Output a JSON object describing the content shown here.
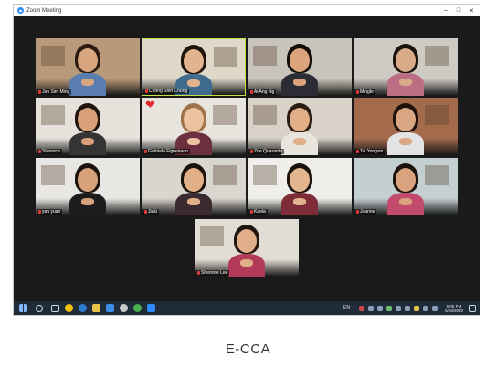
{
  "window": {
    "title": "Zoom Meeting"
  },
  "tiles": [
    {
      "name": "Jan Sim Ming",
      "bg": "#b89a7a",
      "skin": "#d7a57e",
      "hair": "#2a1a10",
      "shirt": "#5a7db0",
      "muted": true
    },
    {
      "name": "Chong Shin Chong",
      "bg": "#ded8c8",
      "skin": "#e2b48e",
      "hair": "#1e140c",
      "shirt": "#3f6b8c",
      "muted": true,
      "active": true
    },
    {
      "name": "Ai Ang Ng",
      "bg": "#c9c4bb",
      "skin": "#dba47c",
      "hair": "#150d08",
      "shirt": "#2c2c34",
      "muted": true
    },
    {
      "name": "Mingle",
      "bg": "#cfcac3",
      "skin": "#d9ab88",
      "hair": "#1a120c",
      "shirt": "#ba6d83",
      "muted": true
    },
    {
      "name": "Shernice",
      "bg": "#e6e2db",
      "skin": "#d7a07a",
      "hair": "#1f150d",
      "shirt": "#343434",
      "muted": true
    },
    {
      "name": "Gabriela Figueiredo",
      "bg": "#e8e4de",
      "skin": "#ebc3a0",
      "hair": "#a0724a",
      "shirt": "#6b2f3f",
      "muted": true
    },
    {
      "name": "Zoe Quaranta",
      "bg": "#d8d2c8",
      "skin": "#e0ae87",
      "hair": "#2a1c12",
      "shirt": "#e8e4de",
      "muted": true
    },
    {
      "name": "Tai Yongxin",
      "bg": "#a36a4c",
      "skin": "#d9a784",
      "hair": "#1c120a",
      "shirt": "#e3e3e3",
      "muted": true
    },
    {
      "name": "yan yuan",
      "bg": "#e9e7e3",
      "skin": "#d6a27c",
      "hair": "#1a120b",
      "shirt": "#1d1d1d",
      "muted": true
    },
    {
      "name": "Jiaki",
      "bg": "#d9d5cf",
      "skin": "#e1b089",
      "hair": "#1c130b",
      "shirt": "#3b2a2f",
      "muted": true
    },
    {
      "name": "Kaela",
      "bg": "#efeeea",
      "skin": "#e4b690",
      "hair": "#1a120b",
      "shirt": "#7e2c38",
      "muted": true
    },
    {
      "name": "Joanne",
      "bg": "#c4cfd2",
      "skin": "#d8a37e",
      "hair": "#1a120b",
      "shirt": "#c24a6c",
      "muted": true
    },
    {
      "name": "Shernice Lee",
      "bg": "#e2ddd4",
      "skin": "#e0ae88",
      "hair": "#20150d",
      "shirt": "#b23b59",
      "muted": true
    }
  ],
  "taskbar": {
    "lang": "EN",
    "time": "6:05 PM",
    "date": "5/18/2020"
  },
  "caption": "E-CCA",
  "colors": {
    "active_border": "#c6e04a",
    "taskbar": "#202b3a",
    "window_bg": "#1a1a1a"
  }
}
